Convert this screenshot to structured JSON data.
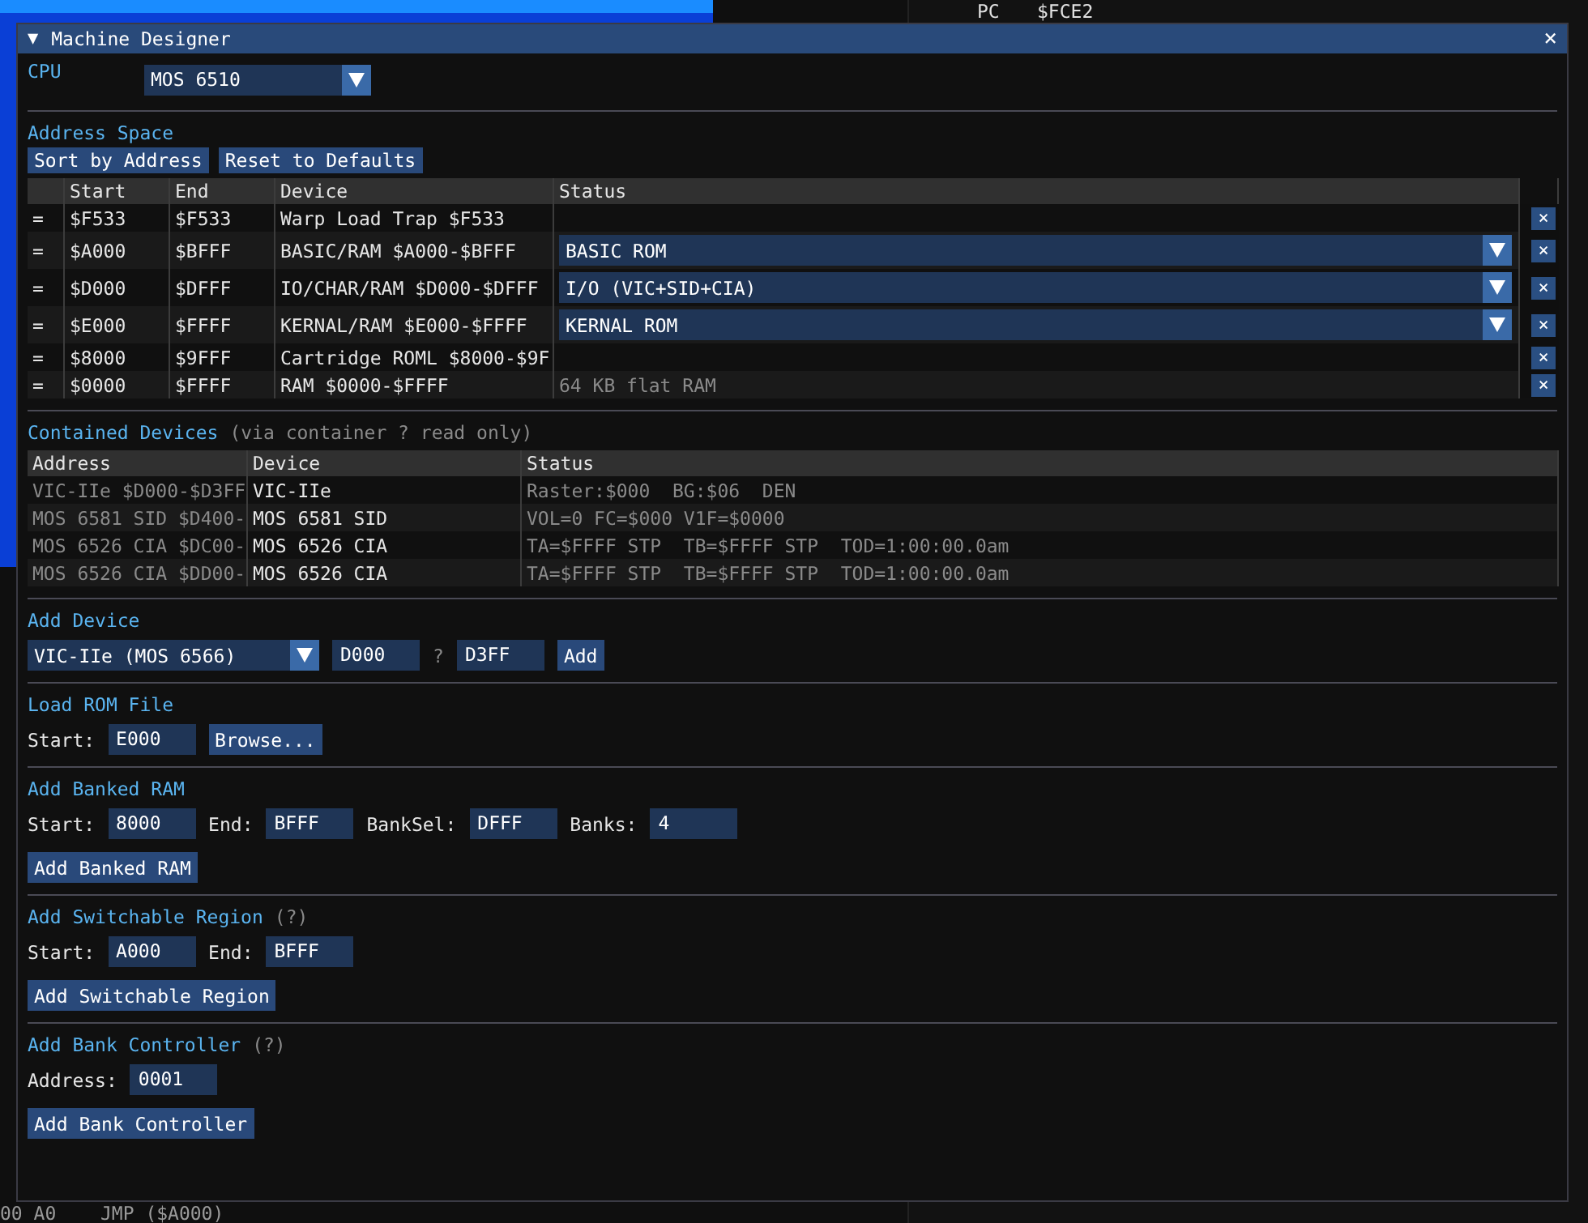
{
  "background": {
    "registers": [
      {
        "name": "PC",
        "value": "$FCE2"
      }
    ],
    "disassembly_line": {
      "bytes": "00 A0",
      "instruction": "JMP ($A000)"
    }
  },
  "window": {
    "title": "Machine Designer",
    "collapse": "▼",
    "close": "×"
  },
  "cpu": {
    "label": "CPU",
    "value": "MOS 6510"
  },
  "address_space": {
    "title": "Address Space",
    "buttons": [
      "Sort by Address",
      "Reset to Defaults"
    ],
    "columns": [
      "Start",
      "End",
      "Device",
      "Status"
    ],
    "rows": [
      {
        "handle": "=",
        "start": "$F533",
        "end": "$F533",
        "device": "Warp Load Trap $F533",
        "remove": "×"
      },
      {
        "handle": "=",
        "start": "$A000",
        "end": "$BFFF",
        "device": "BASIC/RAM $A000-$BFFF",
        "status": {
          "kind": "combo",
          "value": "BASIC ROM"
        },
        "remove": "×"
      },
      {
        "handle": "=",
        "start": "$D000",
        "end": "$DFFF",
        "device": "IO/CHAR/RAM $D000-$DFFF",
        "status": {
          "kind": "combo",
          "value": "I/O (VIC+SID+CIA)"
        },
        "remove": "×"
      },
      {
        "handle": "=",
        "start": "$E000",
        "end": "$FFFF",
        "device": "KERNAL/RAM $E000-$FFFF",
        "status": {
          "kind": "combo",
          "value": "KERNAL ROM"
        },
        "remove": "×"
      },
      {
        "handle": "=",
        "start": "$8000",
        "end": "$9FFF",
        "device": "Cartridge ROML $8000-$9F",
        "remove": "×"
      },
      {
        "handle": "=",
        "start": "$0000",
        "end": "$FFFF",
        "device": "RAM $0000-$FFFF",
        "status": {
          "kind": "text",
          "value": "64 KB flat RAM"
        },
        "remove": "×"
      }
    ]
  },
  "contained": {
    "title": "Contained Devices",
    "note": "(via container ? read only)",
    "columns": [
      "Address",
      "Device",
      "Status"
    ],
    "rows": [
      {
        "address": "VIC-IIe $D000-$D3FF",
        "device": "VIC-IIe",
        "status": "Raster:$000  BG:$06  DEN"
      },
      {
        "address": "MOS 6581 SID $D400-",
        "device": "MOS 6581 SID",
        "status": "VOL=0 FC=$000 V1F=$0000"
      },
      {
        "address": "MOS 6526 CIA $DC00-",
        "device": "MOS 6526 CIA",
        "status": "TA=$FFFF STP  TB=$FFFF STP  TOD=1:00:00.0am"
      },
      {
        "address": "MOS 6526 CIA $DD00-",
        "device": "MOS 6526 CIA",
        "status": "TA=$FFFF STP  TB=$FFFF STP  TOD=1:00:00.0am"
      }
    ]
  },
  "forms": [
    {
      "title": "Add Device",
      "rows": [
        [
          {
            "kind": "combo",
            "value": "VIC-IIe (MOS 6566)"
          },
          {
            "kind": "input",
            "value": "D000"
          },
          {
            "kind": "hint",
            "text": "?"
          },
          {
            "kind": "input",
            "value": "D3FF"
          },
          {
            "kind": "button",
            "text": "Add"
          }
        ]
      ]
    },
    {
      "title": "Load ROM File",
      "rows": [
        [
          {
            "kind": "label",
            "text": "Start:"
          },
          {
            "kind": "input",
            "value": "E000"
          },
          {
            "kind": "button",
            "text": "Browse..."
          }
        ]
      ]
    },
    {
      "title": "Add Banked RAM",
      "rows": [
        [
          {
            "kind": "label",
            "text": "Start:"
          },
          {
            "kind": "input",
            "value": "8000"
          },
          {
            "kind": "label",
            "text": "End:"
          },
          {
            "kind": "input",
            "value": "BFFF"
          },
          {
            "kind": "label",
            "text": "BankSel:"
          },
          {
            "kind": "input",
            "value": "DFFF"
          },
          {
            "kind": "label",
            "text": "Banks:"
          },
          {
            "kind": "input",
            "value": "4"
          }
        ],
        [
          {
            "kind": "button",
            "text": "Add Banked RAM"
          }
        ]
      ]
    },
    {
      "title": "Add Switchable Region",
      "help": "(?)",
      "rows": [
        [
          {
            "kind": "label",
            "text": "Start:"
          },
          {
            "kind": "input",
            "value": "A000"
          },
          {
            "kind": "label",
            "text": "End:"
          },
          {
            "kind": "input",
            "value": "BFFF"
          }
        ],
        [
          {
            "kind": "button",
            "text": "Add Switchable Region"
          }
        ]
      ]
    },
    {
      "title": "Add Bank Controller",
      "help": "(?)",
      "rows": [
        [
          {
            "kind": "label",
            "text": "Address:"
          },
          {
            "kind": "input",
            "value": "0001"
          }
        ],
        [
          {
            "kind": "button",
            "text": "Add Bank Controller"
          }
        ]
      ]
    }
  ]
}
